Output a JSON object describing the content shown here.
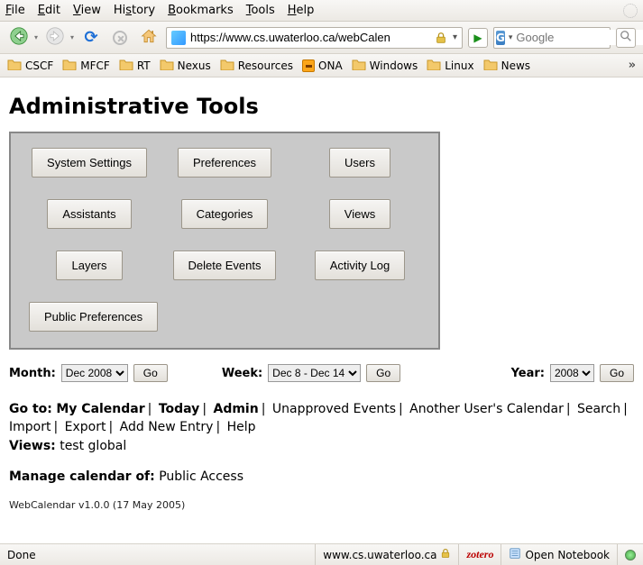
{
  "menubar": {
    "items": [
      "File",
      "Edit",
      "View",
      "History",
      "Bookmarks",
      "Tools",
      "Help"
    ]
  },
  "toolbar": {
    "url": "https://www.cs.uwaterloo.ca/webCalen",
    "search_placeholder": "Google",
    "search_engine_glyph": "G"
  },
  "bookmarks": [
    {
      "label": "CSCF",
      "icon": "folder"
    },
    {
      "label": "MFCF",
      "icon": "folder"
    },
    {
      "label": "RT",
      "icon": "folder"
    },
    {
      "label": "Nexus",
      "icon": "folder"
    },
    {
      "label": "Resources",
      "icon": "folder"
    },
    {
      "label": "ONA",
      "icon": "ona"
    },
    {
      "label": "Windows",
      "icon": "folder"
    },
    {
      "label": "Linux",
      "icon": "folder"
    },
    {
      "label": "News",
      "icon": "folder"
    }
  ],
  "overflow_glyph": "»",
  "page": {
    "title": "Administrative Tools",
    "buttons": [
      [
        "System Settings",
        "Preferences",
        "Users"
      ],
      [
        "Assistants",
        "Categories",
        "Views"
      ],
      [
        "Layers",
        "Delete Events",
        "Activity Log"
      ],
      [
        "Public Preferences"
      ]
    ],
    "selects": {
      "month": {
        "label": "Month:",
        "value": "Dec 2008",
        "go": "Go"
      },
      "week": {
        "label": "Week:",
        "value": "Dec 8 - Dec 14",
        "go": "Go"
      },
      "year": {
        "label": "Year:",
        "value": "2008",
        "go": "Go"
      }
    },
    "links": {
      "goto_label": "Go to:",
      "items": [
        "My Calendar",
        "Today",
        "Admin",
        "Unapproved Events",
        "Another User's Calendar",
        "Search",
        "Import",
        "Export",
        "Add New Entry",
        "Help"
      ],
      "views_label": "Views:",
      "views_value": "test global",
      "manage_label": "Manage calendar of:",
      "manage_value": "Public Access"
    },
    "version": "WebCalendar v1.0.0 (17 May 2005)"
  },
  "statusbar": {
    "status": "Done",
    "host": "www.cs.uwaterloo.ca",
    "zotero": "zotero",
    "notebook": "Open Notebook"
  }
}
